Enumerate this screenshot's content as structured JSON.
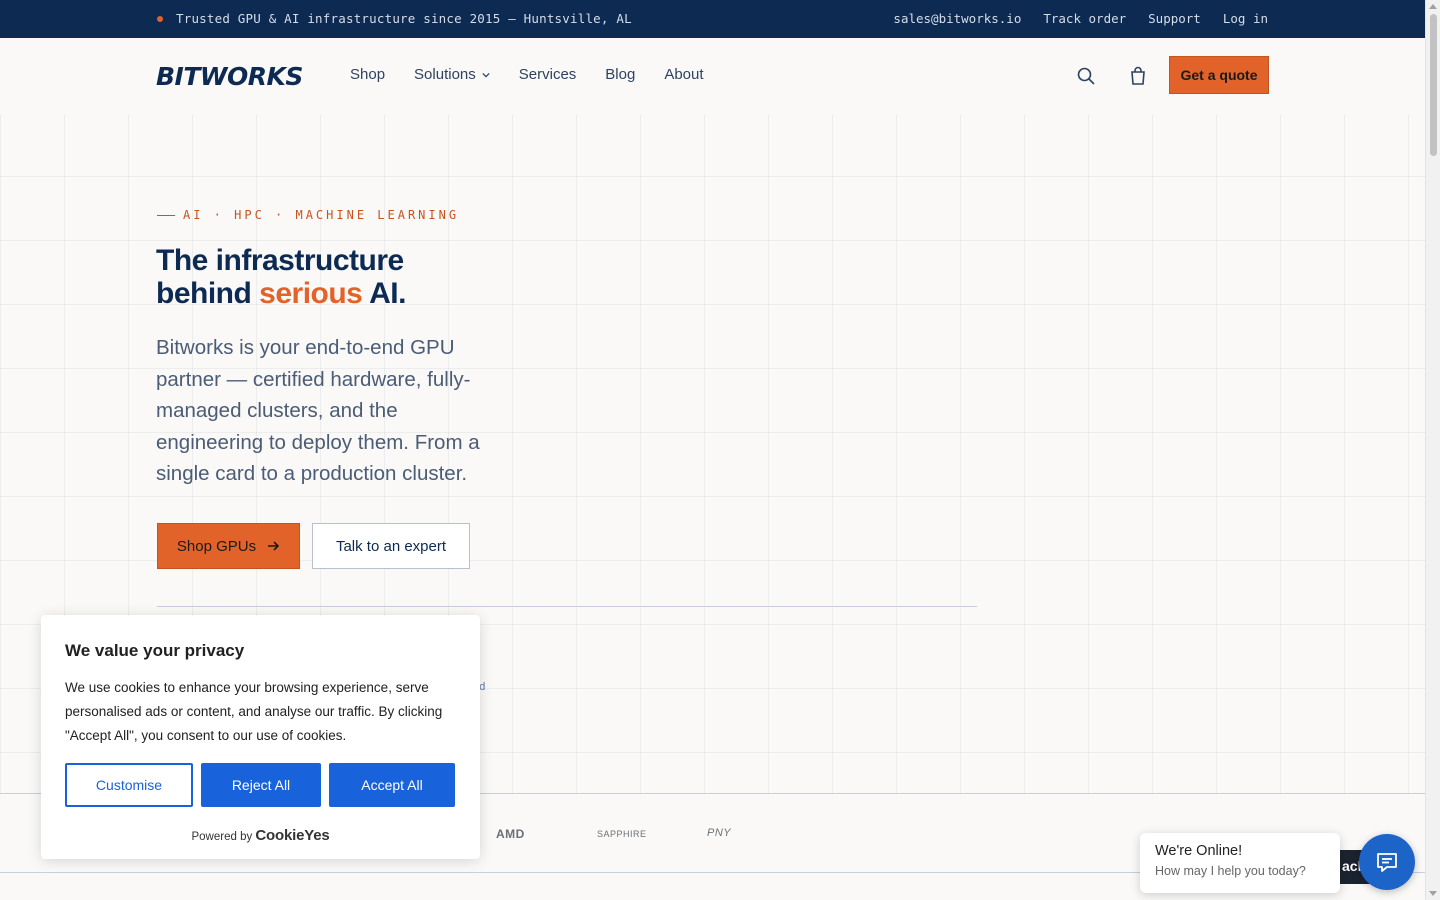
{
  "topbar": {
    "tagline": "Trusted GPU & AI infrastructure since 2015 — Huntsville, AL",
    "links": [
      "sales@bitworks.io",
      "Track order",
      "Support",
      "Log in"
    ]
  },
  "header": {
    "logo_text": "BITWORKS",
    "nav": [
      "Shop",
      "Solutions",
      "Services",
      "Blog",
      "About"
    ],
    "quote_label": "Get a quote"
  },
  "hero": {
    "eyebrow": "AI · HPC · MACHINE LEARNING",
    "headline_line1": "The infrastructure",
    "headline_pre": "behind ",
    "headline_accent": "serious",
    "headline_post": " AI.",
    "lede": "Bitworks is your end-to-end GPU partner — certified hardware, fully-managed clusters, and the engineering to deploy them. From a single card to a production cluster.",
    "primary_cta": "Shop GPUs",
    "secondary_cta": "Talk to an expert",
    "stub_text": "d"
  },
  "partners": [
    "AMD",
    "SAPPHIRE",
    "PNY"
  ],
  "cookie": {
    "title": "We value your privacy",
    "body": "We use cookies to enhance your browsing experience, serve personalised ads or content, and analyse our traffic. By clicking \"Accept All\", you consent to our use of cookies.",
    "customise": "Customise",
    "reject": "Reject All",
    "accept": "Accept All",
    "powered_by": "Powered by",
    "brand": "CookieYes"
  },
  "chat": {
    "title": "We're Online!",
    "subtitle": "How may I help you today?",
    "tab_text": "ack"
  },
  "colors": {
    "navy": "#0c2a52",
    "accent": "#e2632a",
    "cookie_blue": "#1863dc",
    "chat_blue": "#1d64c8"
  }
}
